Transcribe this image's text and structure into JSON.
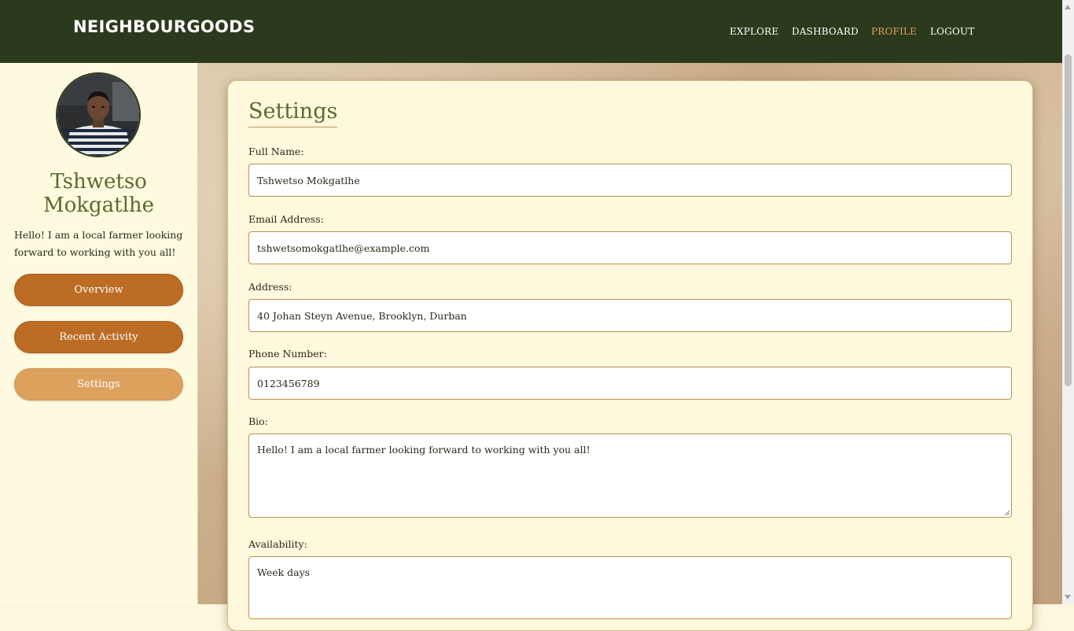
{
  "header": {
    "brand": "NEIGHBOURGOODS",
    "nav": [
      "EXPLORE",
      "DASHBOARD",
      "PROFILE",
      "LOGOUT"
    ],
    "active_nav": "PROFILE"
  },
  "sidebar": {
    "avatar_icon": "user-avatar-photo",
    "name": "Tshwetso Mokgatlhe",
    "bio": "Hello! I am a local farmer looking forward to working with you all!",
    "buttons": [
      "Overview",
      "Recent Activity",
      "Settings"
    ],
    "active_button": "Settings"
  },
  "settings": {
    "title": "Settings",
    "fields": [
      {
        "label": "Full Name:",
        "value": "Tshwetso Mokgatlhe"
      },
      {
        "label": "Email Address:",
        "value": "tshwetsomokgatlhe@example.com"
      },
      {
        "label": "Address:",
        "value": "40 Johan Steyn Avenue, Brooklyn, Durban"
      },
      {
        "label": "Phone Number:",
        "value": "0123456789"
      },
      {
        "label": "Bio:",
        "value": "Hello! I am a local farmer looking forward to working with you all!"
      },
      {
        "label": "Availability:",
        "value": "Week days"
      }
    ]
  },
  "colors": {
    "navbar": "#2b3a1c",
    "accent": "#dda15e",
    "button": "#bc6c25",
    "heading": "#5b6a2e"
  }
}
